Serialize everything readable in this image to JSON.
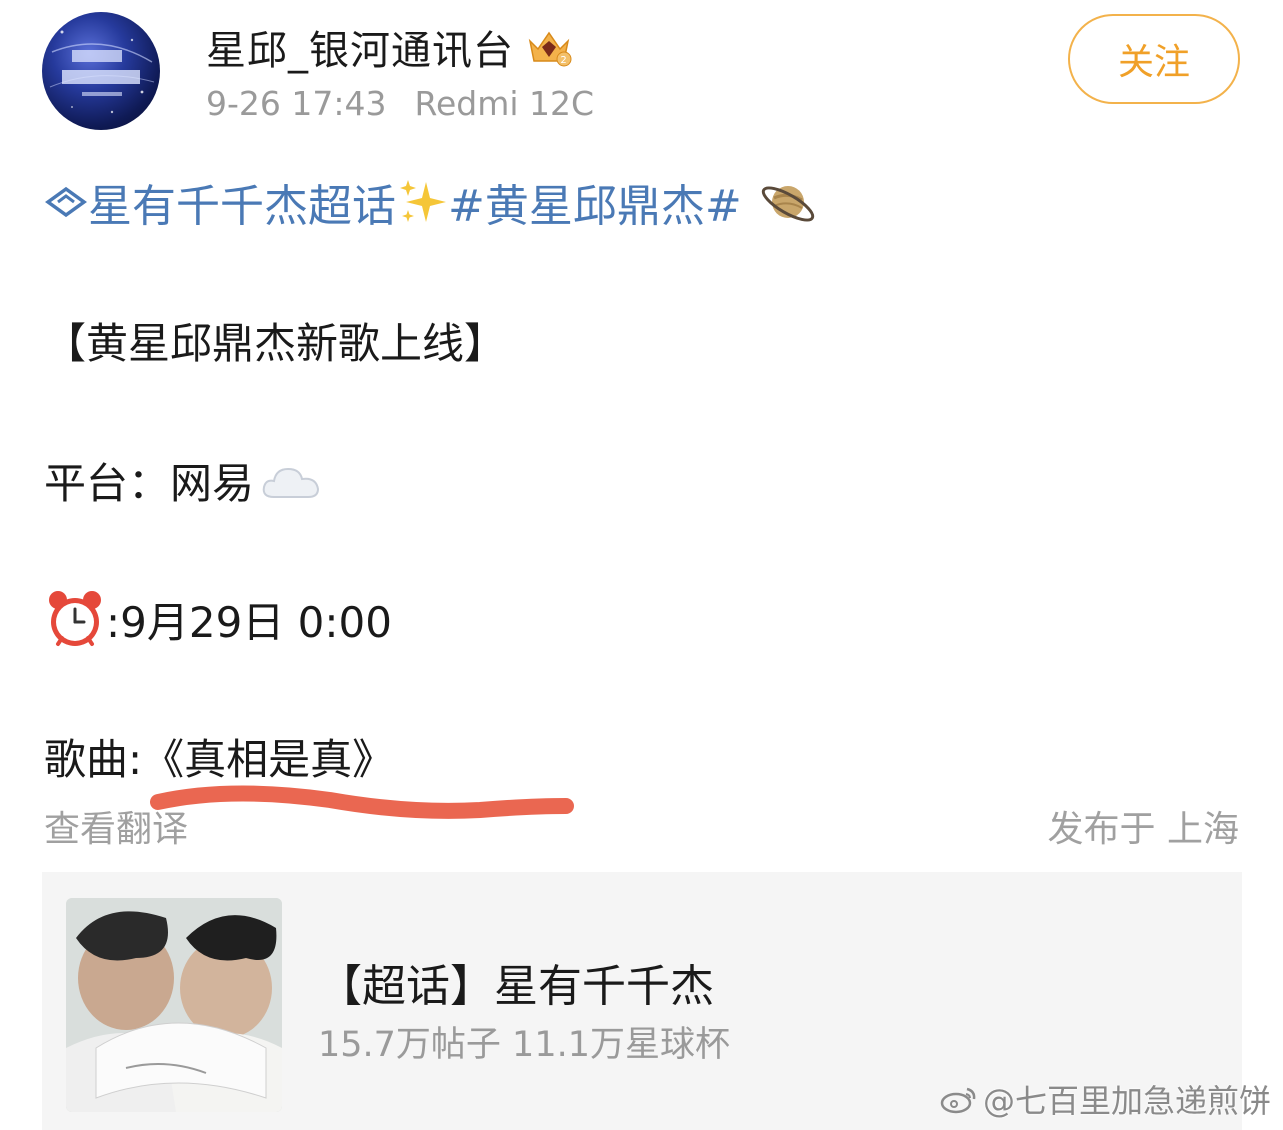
{
  "post": {
    "username": "星邱_银河通讯台",
    "timestamp": "9-26 17:43",
    "device": "Redmi 12C",
    "follow_label": "关注",
    "topic_name": "星有千千杰超话",
    "hashtag": "#黄星邱鼎杰#",
    "line_heading": "【黄星邱鼎杰新歌上线】",
    "line_platform": "平台：网易",
    "line_time": ":9月29日 0:00",
    "line_song": "歌曲:《真相是真》",
    "translate_label": "查看翻译",
    "location_label": "发布于 上海"
  },
  "card": {
    "title": "【超话】星有千千杰",
    "stats": "15.7万帖子 11.1万星球杯"
  },
  "watermark": {
    "text": "@七百里加急递煎饼"
  },
  "colors": {
    "link_blue": "#4a79b5",
    "follow_orange": "#f0a028",
    "meta_gray": "#9a9a9a",
    "highlight_red": "#e8563e"
  },
  "icons": [
    "avatar",
    "crown-badge-icon",
    "diamond-topic-icon",
    "sparkles-icon",
    "planet-icon",
    "cloud-icon",
    "alarm-clock-icon",
    "weibo-logo-icon"
  ]
}
